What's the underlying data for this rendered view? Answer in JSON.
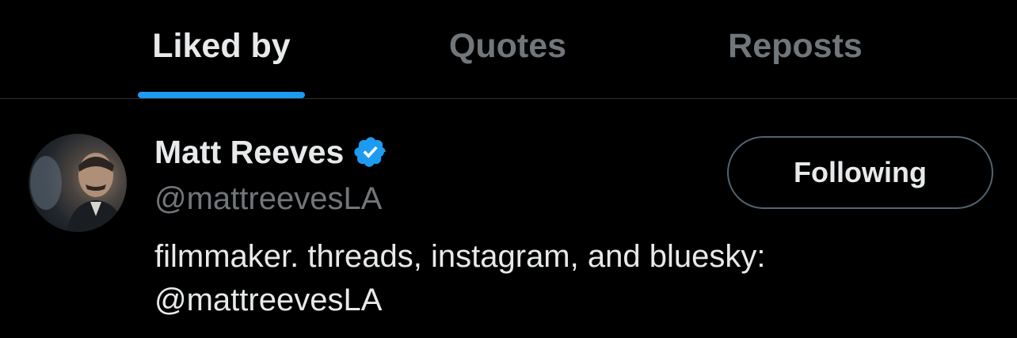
{
  "tabs": [
    {
      "label": "Liked by",
      "active": true
    },
    {
      "label": "Quotes",
      "active": false
    },
    {
      "label": "Reposts",
      "active": false
    }
  ],
  "colors": {
    "background": "#000000",
    "accent": "#1d9bf0",
    "text_primary": "#e7e9ea",
    "text_secondary": "#71767b",
    "divider": "#2f3336"
  },
  "user": {
    "display_name": "Matt Reeves",
    "verified": true,
    "verified_icon": "verified-badge-icon",
    "handle": "@mattreevesLA",
    "follow_button_label": "Following",
    "bio_line1": "filmmaker. threads, instagram, and bluesky:",
    "bio_line2": "@mattreevesLA"
  }
}
